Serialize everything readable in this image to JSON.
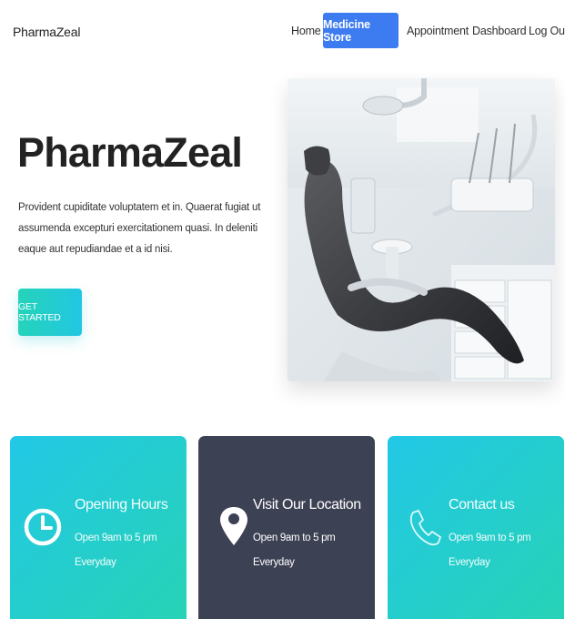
{
  "navbar": {
    "brand": "PharmaZeal",
    "links": [
      "Home",
      "Medicine Store",
      "Appointment",
      "Dashboard",
      "Log Out"
    ],
    "active": "Medicine Store"
  },
  "hero": {
    "title": "PharmaZeal",
    "description": "Provident cupiditate voluptatem et in. Quaerat fugiat ut assumenda excepturi exercitationem quasi. In deleniti eaque aut repudiandae et a id nisi.",
    "cta_label": "GET STARTED",
    "image": "dental-chair-photo"
  },
  "cards": [
    {
      "icon": "clock-icon",
      "title": "Opening Hours",
      "line1": "Open 9am to 5 pm",
      "line2": "Everyday"
    },
    {
      "icon": "location-pin-icon",
      "title": "Visit Our Location",
      "line1": "Open 9am to 5 pm",
      "line2": "Everyday"
    },
    {
      "icon": "phone-icon",
      "title": "Contact us",
      "line1": "Open 9am to 5 pm",
      "line2": "Everyday"
    }
  ],
  "colors": {
    "primary": "#3d7cf0",
    "teal": "#25d3b9",
    "cyan": "#22c7e2",
    "dark_card": "#3d4154"
  }
}
